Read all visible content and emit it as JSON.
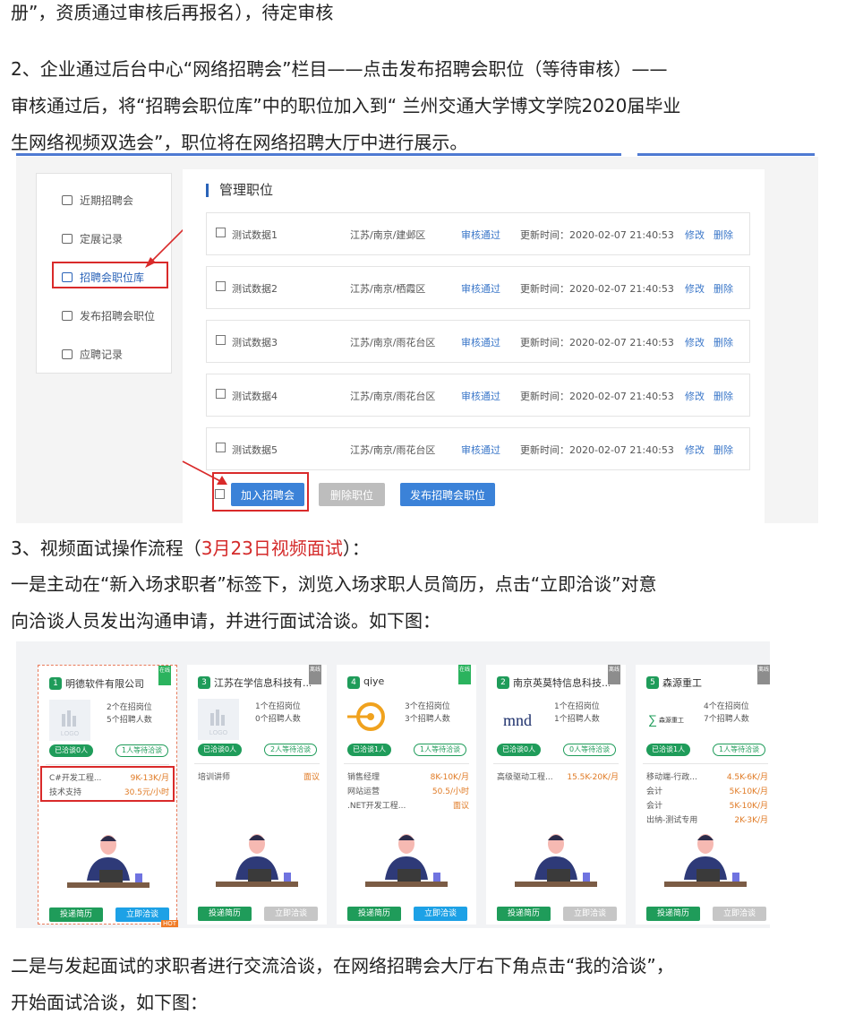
{
  "text": {
    "line_top": "册”，资质通过审核后再报名），待定审核",
    "p2_line1": "2、企业通过后台中心“网络招聘会”栏目——点击发布招聘会职位（等待审核）——",
    "p2_line2": "审核通过后，将“招聘会职位库”中的职位加入到“ 兰州交通大学博文学院2020届毕业",
    "p2_line3": "生网络视频双选会”，职位将在网络招聘大厅中进行展示。",
    "p3_prefix": "3、视频面试操作流程（",
    "p3_red": "3月23日视频面试",
    "p3_suffix": "）：",
    "p4_line1": "一是主动在“新入场求职者”标签下，浏览入场求职人员简历，点击“立即洽谈”对意",
    "p4_line2": "向洽谈人员发出沟通申请，并进行面试洽谈。如下图：",
    "p5_line1": "二是与发起面试的求职者进行交流洽谈，在网络招聘会大厅右下角点击“我的洽谈”，",
    "p5_line2": "开始面试洽谈，如下图："
  },
  "admin": {
    "sidebar": [
      "近期招聘会",
      "定展记录",
      "招聘会职位库",
      "发布招聘会职位",
      "应聘记录"
    ],
    "panel_title": "管理职位",
    "jobs": [
      {
        "name": "测试数据1",
        "loc": "江苏/南京/建邺区",
        "status": "审核通过",
        "updated": "更新时间：2020-02-07 21:40:53",
        "edit": "修改",
        "del": "删除"
      },
      {
        "name": "测试数据2",
        "loc": "江苏/南京/栖霞区",
        "status": "审核通过",
        "updated": "更新时间：2020-02-07 21:40:53",
        "edit": "修改",
        "del": "删除"
      },
      {
        "name": "测试数据3",
        "loc": "江苏/南京/雨花台区",
        "status": "审核通过",
        "updated": "更新时间：2020-02-07 21:40:53",
        "edit": "修改",
        "del": "删除"
      },
      {
        "name": "测试数据4",
        "loc": "江苏/南京/雨花台区",
        "status": "审核通过",
        "updated": "更新时间：2020-02-07 21:40:53",
        "edit": "修改",
        "del": "删除"
      },
      {
        "name": "测试数据5",
        "loc": "江苏/南京/雨花台区",
        "status": "审核通过",
        "updated": "更新时间：2020-02-07 21:40:53",
        "edit": "修改",
        "del": "删除"
      }
    ],
    "btn_add": "加入招聘会",
    "btn_delete": "删除职位",
    "btn_publish": "发布招聘会职位"
  },
  "cards": [
    {
      "num": "1",
      "name": "明德软件有限公司",
      "flag": "在线",
      "logo_text": "LOGO",
      "positions": "2个在招岗位",
      "headcount": "5个招聘人数",
      "talking": "已洽谈0人",
      "waiting": "1人等待洽谈",
      "jobs": [
        {
          "t": "C#开发工程...",
          "s": "9K-13K/月"
        },
        {
          "t": "技术支持",
          "s": "30.5元/小时"
        }
      ],
      "btn1": "投递简历",
      "btn2": "立即洽谈",
      "hot": "HOT"
    },
    {
      "num": "3",
      "name": "江苏在学信息科技有...",
      "flag": "离线",
      "logo_text": "LOGO",
      "positions": "1个在招岗位",
      "headcount": "0个招聘人数",
      "talking": "已洽谈0人",
      "waiting": "2人等待洽谈",
      "jobs": [
        {
          "t": "培训讲师",
          "s": "面议"
        }
      ],
      "btn1": "投递简历",
      "btn2": "立即洽谈"
    },
    {
      "num": "4",
      "name": "qiye",
      "flag": "在线",
      "logo_text": "",
      "positions": "3个在招岗位",
      "headcount": "3个招聘人数",
      "talking": "已洽谈1人",
      "waiting": "1人等待洽谈",
      "jobs": [
        {
          "t": "销售经理",
          "s": "8K-10K/月"
        },
        {
          "t": "网站运营",
          "s": "50.5/小时"
        },
        {
          "t": ".NET开发工程...",
          "s": "面议"
        }
      ],
      "btn1": "投递简历",
      "btn2": "立即洽谈"
    },
    {
      "num": "2",
      "name": "南京英莫特信息科技...",
      "flag": "离线",
      "logo_text": "mnd",
      "positions": "1个在招岗位",
      "headcount": "1个招聘人数",
      "talking": "已洽谈0人",
      "waiting": "0人等待洽谈",
      "jobs": [
        {
          "t": "高级驱动工程...",
          "s": "15.5K-20K/月"
        }
      ],
      "btn1": "投递简历",
      "btn2": "立即洽谈"
    },
    {
      "num": "5",
      "name": "森源重工",
      "flag": "离线",
      "logo_text": "森源重工",
      "positions": "4个在招岗位",
      "headcount": "7个招聘人数",
      "talking": "已洽谈1人",
      "waiting": "1人等待洽谈",
      "jobs": [
        {
          "t": "移动端-行政...",
          "s": "4.5K-6K/月"
        },
        {
          "t": "会计",
          "s": "5K-10K/月"
        },
        {
          "t": "会计",
          "s": "5K-10K/月"
        },
        {
          "t": "出纳-测试专用",
          "s": "2K-3K/月"
        }
      ],
      "btn1": "投递简历",
      "btn2": "立即洽谈"
    }
  ],
  "colors": {
    "accent": "#2a63b8",
    "red": "#d42a2a",
    "green": "#1f9c5a"
  }
}
